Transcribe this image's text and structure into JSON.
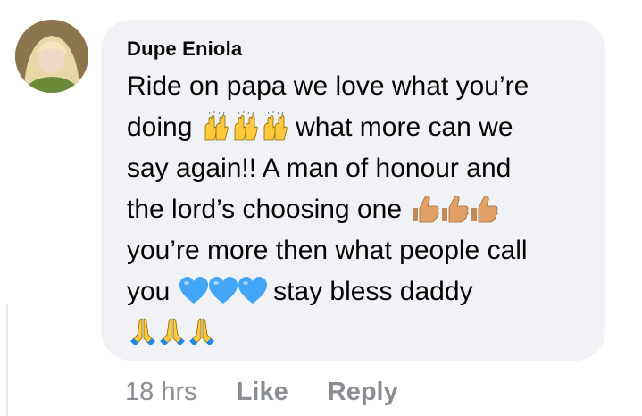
{
  "comment": {
    "author": "Dupe Eniola",
    "text_lines": [
      "Ride on papa we love what you’re",
      "doing",
      "what more can we",
      "say again!! A man of honour and",
      "the lord’s choosing one",
      "you’re more then what people call",
      "you",
      "stay bless daddy"
    ],
    "emoji": {
      "raised_hands": "raised-hands-icon",
      "thumbs_up": "thumbs-up-icon",
      "blue_heart": "blue-heart-icon",
      "folded_hands": "folded-hands-icon"
    }
  },
  "actions": {
    "time": "18 hrs",
    "like_label": "Like",
    "reply_label": "Reply"
  },
  "colors": {
    "bubble": "#f0f2f5",
    "muted": "#8a8d91",
    "text": "#050505",
    "heart": "#42a5f5"
  }
}
